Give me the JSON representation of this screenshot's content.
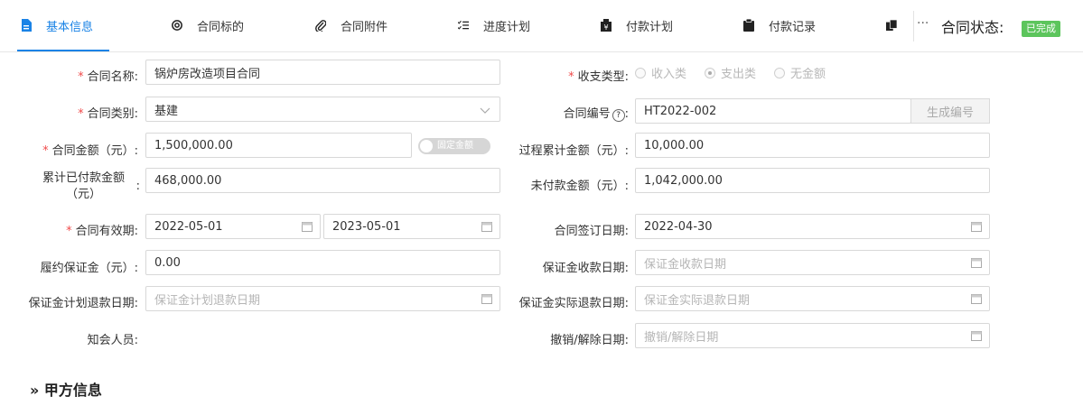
{
  "tabs": [
    {
      "label": "基本信息",
      "icon": "document-icon"
    },
    {
      "label": "合同标的",
      "icon": "target-icon"
    },
    {
      "label": "合同附件",
      "icon": "paperclip-icon"
    },
    {
      "label": "进度计划",
      "icon": "checklist-icon"
    },
    {
      "label": "付款计划",
      "icon": "payment-plan-icon"
    },
    {
      "label": "付款记录",
      "icon": "clipboard-icon"
    }
  ],
  "more_label": "···",
  "status": {
    "label": "合同状态:",
    "value": "已完成",
    "color": "#5cc55c"
  },
  "accent_color": "#1a83e6",
  "form": {
    "contract_name": {
      "label": "合同名称:",
      "value": "锅炉房改造项目合同"
    },
    "income_type": {
      "label": "收支类型:",
      "options": [
        "收入类",
        "支出类",
        "无金额"
      ],
      "selected": "支出类"
    },
    "category": {
      "label": "合同类别:",
      "value": "基建"
    },
    "contract_no": {
      "label": "合同编号",
      "value": "HT2022-002",
      "button": "生成编号"
    },
    "amount": {
      "label": "合同金额（元）:",
      "value": "1,500,000.00",
      "switch_label": "固定金额"
    },
    "process_total": {
      "label": "过程累计金额（元）:",
      "value": "10,000.00"
    },
    "paid_total": {
      "label": "累计已付款金额（元）",
      "value": "468,000.00"
    },
    "unpaid": {
      "label": "未付款金额（元）:",
      "value": "1,042,000.00"
    },
    "validity": {
      "label": "合同有效期:",
      "start": "2022-05-01",
      "end": "2023-05-01"
    },
    "sign_date": {
      "label": "合同签订日期:",
      "value": "2022-04-30"
    },
    "deposit": {
      "label": "履约保证金（元）:",
      "value": "0.00"
    },
    "deposit_receive_date": {
      "label": "保证金收款日期:",
      "placeholder": "保证金收款日期"
    },
    "deposit_plan_refund": {
      "label": "保证金计划退款日期:",
      "placeholder": "保证金计划退款日期"
    },
    "deposit_actual_refund": {
      "label": "保证金实际退款日期:",
      "placeholder": "保证金实际退款日期"
    },
    "notify": {
      "label": "知会人员:"
    },
    "cancel_date": {
      "label": "撤销/解除日期:",
      "placeholder": "撤销/解除日期"
    }
  },
  "section_title": "» 甲方信息"
}
